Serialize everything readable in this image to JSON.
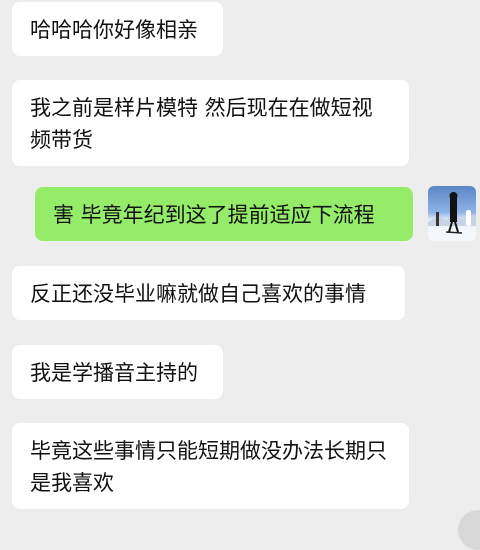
{
  "conversation": {
    "messages": [
      {
        "direction": "incoming",
        "text": "哈哈哈你好像相亲"
      },
      {
        "direction": "incoming",
        "text": "我之前是样片模特 然后现在在做短视频带货"
      },
      {
        "direction": "outgoing",
        "text": "害 毕竟年纪到这了提前适应下流程"
      },
      {
        "direction": "incoming",
        "text": "反正还没毕业嘛就做自己喜欢的事情"
      },
      {
        "direction": "incoming",
        "text": "我是学播音主持的"
      },
      {
        "direction": "incoming",
        "text": "毕竟这些事情只能短期做没办法长期只是我喜欢"
      }
    ]
  },
  "colors": {
    "background": "#EDEDED",
    "incoming_bubble": "#FFFFFF",
    "outgoing_bubble": "#95EC69",
    "text": "#111111"
  },
  "icons": {
    "sender_avatar": "avatar-icon"
  }
}
